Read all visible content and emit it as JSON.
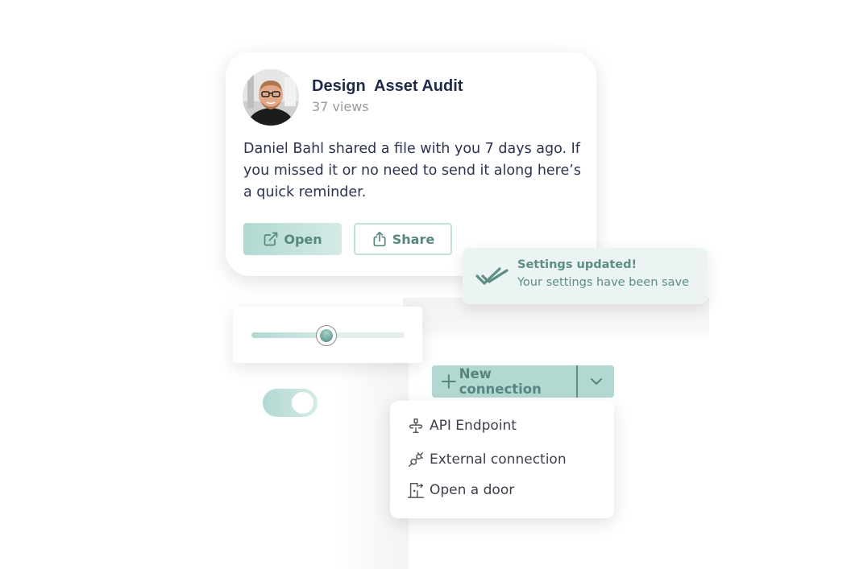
{
  "share_card": {
    "avatar_alt": "Daniel Bahl",
    "title": "Design  Asset Audit",
    "views": "37 views",
    "message": "Daniel Bahl shared a file with you 7 days ago. If you missed it or no need to send it along here’s a quick reminder.",
    "open_label": "Open",
    "share_label": "Share",
    "open_icon": "external-link-icon",
    "share_icon": "share-upload-icon"
  },
  "toast": {
    "icon": "double-check-icon",
    "title": "Settings updated!",
    "message": "Your settings have been save"
  },
  "slider": {
    "value_fraction": 0.49
  },
  "toggle": {
    "on": true
  },
  "split_button": {
    "icon": "plus-icon",
    "label": "New connection",
    "caret_icon": "chevron-down-icon"
  },
  "menu": {
    "items": [
      {
        "label": "API Endpoint",
        "icon": "api-icon"
      },
      {
        "label": "External connection",
        "icon": "plug-connection-icon"
      },
      {
        "label": "Open a door",
        "icon": "door-open-icon"
      }
    ]
  },
  "colors": {
    "accent": "#b2d8d2",
    "accent_text": "#56877f",
    "title_text": "#1f2a4a",
    "toast_bg": "#ebf4f3"
  }
}
